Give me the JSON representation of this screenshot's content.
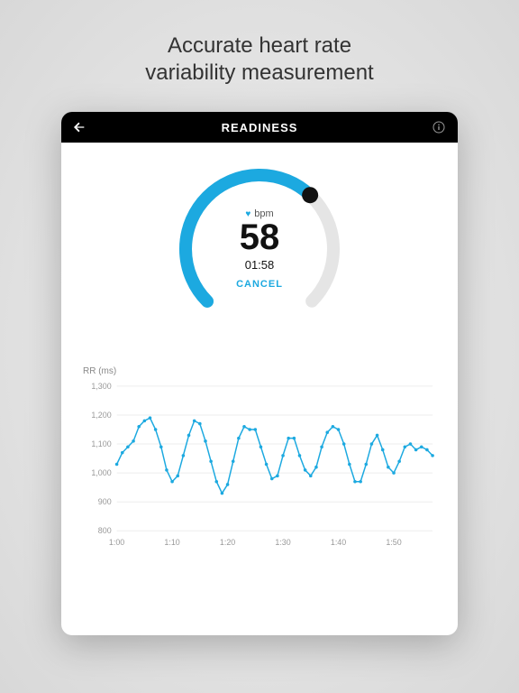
{
  "promo": {
    "line1": "Accurate heart rate",
    "line2": "variability measurement"
  },
  "header": {
    "title": "READINESS"
  },
  "gauge": {
    "bpm_unit": "bpm",
    "bpm_value": "58",
    "timer": "01:58",
    "cancel_label": "CANCEL",
    "progress_fraction": 0.66
  },
  "chart_data": {
    "type": "line",
    "title": "RR (ms)",
    "xlabel": "",
    "ylabel": "RR (ms)",
    "ylim": [
      800,
      1300
    ],
    "y_ticks": [
      800,
      900,
      1000,
      1100,
      1200,
      1300
    ],
    "x_ticks": [
      "1:00",
      "1:10",
      "1:20",
      "1:30",
      "1:40",
      "1:50"
    ],
    "x": [
      60,
      61,
      62,
      63,
      64,
      65,
      66,
      67,
      68,
      69,
      70,
      71,
      72,
      73,
      74,
      75,
      76,
      77,
      78,
      79,
      80,
      81,
      82,
      83,
      84,
      85,
      86,
      87,
      88,
      89,
      90,
      91,
      92,
      93,
      94,
      95,
      96,
      97,
      98,
      99,
      100,
      101,
      102,
      103,
      104,
      105,
      106,
      107,
      108,
      109,
      110,
      111,
      112,
      113,
      114,
      115,
      116,
      117
    ],
    "values": [
      1030,
      1070,
      1090,
      1110,
      1160,
      1180,
      1190,
      1150,
      1090,
      1010,
      970,
      990,
      1060,
      1130,
      1180,
      1170,
      1110,
      1040,
      970,
      930,
      960,
      1040,
      1120,
      1160,
      1150,
      1150,
      1090,
      1030,
      980,
      990,
      1060,
      1120,
      1120,
      1060,
      1010,
      990,
      1020,
      1090,
      1140,
      1160,
      1150,
      1100,
      1030,
      970,
      970,
      1030,
      1100,
      1130,
      1080,
      1020,
      1000,
      1040,
      1090,
      1100,
      1080,
      1090,
      1080,
      1060
    ]
  }
}
